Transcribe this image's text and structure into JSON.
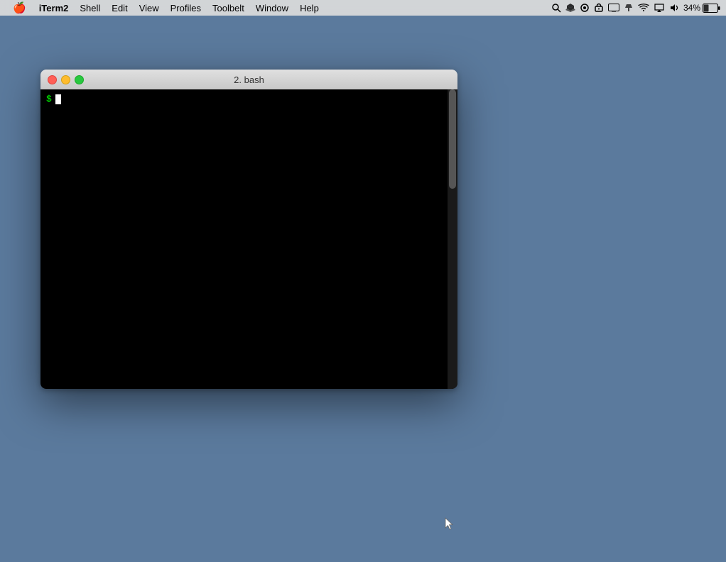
{
  "menubar": {
    "apple": "🍎",
    "app_name": "iTerm2",
    "menus": [
      "Shell",
      "Edit",
      "View",
      "Profiles",
      "Toolbelt",
      "Window",
      "Help"
    ]
  },
  "status_bar": {
    "battery_percent": "34%",
    "time_label": ""
  },
  "terminal": {
    "title": "2. bash",
    "prompt_symbol": "$",
    "cursor_visible": true
  }
}
